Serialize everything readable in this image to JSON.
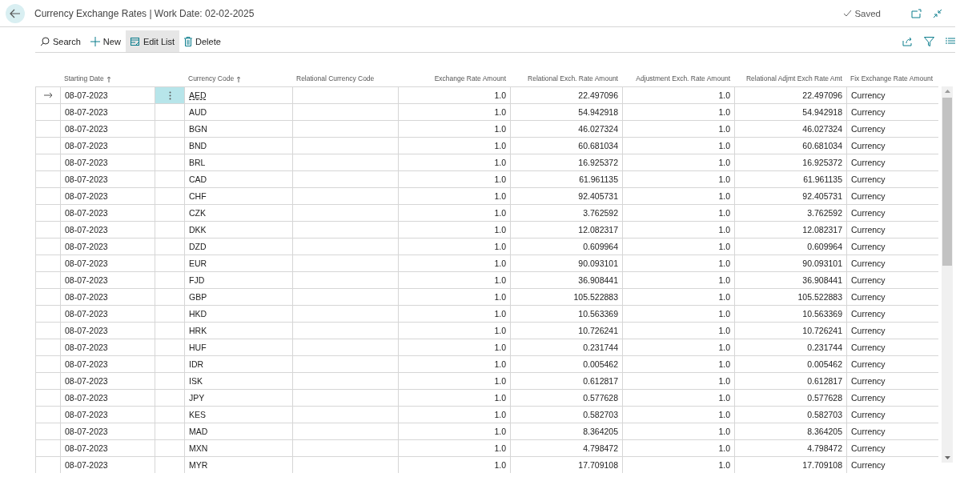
{
  "header": {
    "title": "Currency Exchange Rates | Work Date: 02-02-2025",
    "status": "Saved"
  },
  "actions": [
    {
      "label": "Search",
      "kind": "search",
      "selected": false
    },
    {
      "label": "New",
      "kind": "new",
      "selected": false
    },
    {
      "label": "Edit List",
      "kind": "edit",
      "selected": true
    },
    {
      "label": "Delete",
      "kind": "delete",
      "selected": false
    }
  ],
  "columns": [
    {
      "label": "Starting Date",
      "sorted": true,
      "kind": "text"
    },
    {
      "label": "Currency Code",
      "sorted": true,
      "kind": "text"
    },
    {
      "label": "Relational Currency Code",
      "sorted": false,
      "kind": "text"
    },
    {
      "label": "Exchange Rate Amount",
      "sorted": false,
      "kind": "number"
    },
    {
      "label": "Relational Exch. Rate Amount",
      "sorted": false,
      "kind": "number"
    },
    {
      "label": "Adjustment Exch. Rate Amount",
      "sorted": false,
      "kind": "number"
    },
    {
      "label": "Relational Adjmt Exch Rate Amt",
      "sorted": false,
      "kind": "number"
    },
    {
      "label": "Fix Exchange Rate Amount",
      "sorted": false,
      "kind": "text"
    }
  ],
  "rows": [
    {
      "selected": true,
      "cells": [
        "08-07-2023",
        "AED",
        "",
        "1.0",
        "22.497096",
        "1.0",
        "22.497096",
        "Currency"
      ]
    },
    {
      "selected": false,
      "cells": [
        "08-07-2023",
        "AUD",
        "",
        "1.0",
        "54.942918",
        "1.0",
        "54.942918",
        "Currency"
      ]
    },
    {
      "selected": false,
      "cells": [
        "08-07-2023",
        "BGN",
        "",
        "1.0",
        "46.027324",
        "1.0",
        "46.027324",
        "Currency"
      ]
    },
    {
      "selected": false,
      "cells": [
        "08-07-2023",
        "BND",
        "",
        "1.0",
        "60.681034",
        "1.0",
        "60.681034",
        "Currency"
      ]
    },
    {
      "selected": false,
      "cells": [
        "08-07-2023",
        "BRL",
        "",
        "1.0",
        "16.925372",
        "1.0",
        "16.925372",
        "Currency"
      ]
    },
    {
      "selected": false,
      "cells": [
        "08-07-2023",
        "CAD",
        "",
        "1.0",
        "61.961135",
        "1.0",
        "61.961135",
        "Currency"
      ]
    },
    {
      "selected": false,
      "cells": [
        "08-07-2023",
        "CHF",
        "",
        "1.0",
        "92.405731",
        "1.0",
        "92.405731",
        "Currency"
      ]
    },
    {
      "selected": false,
      "cells": [
        "08-07-2023",
        "CZK",
        "",
        "1.0",
        "3.762592",
        "1.0",
        "3.762592",
        "Currency"
      ]
    },
    {
      "selected": false,
      "cells": [
        "08-07-2023",
        "DKK",
        "",
        "1.0",
        "12.082317",
        "1.0",
        "12.082317",
        "Currency"
      ]
    },
    {
      "selected": false,
      "cells": [
        "08-07-2023",
        "DZD",
        "",
        "1.0",
        "0.609964",
        "1.0",
        "0.609964",
        "Currency"
      ]
    },
    {
      "selected": false,
      "cells": [
        "08-07-2023",
        "EUR",
        "",
        "1.0",
        "90.093101",
        "1.0",
        "90.093101",
        "Currency"
      ]
    },
    {
      "selected": false,
      "cells": [
        "08-07-2023",
        "FJD",
        "",
        "1.0",
        "36.908441",
        "1.0",
        "36.908441",
        "Currency"
      ]
    },
    {
      "selected": false,
      "cells": [
        "08-07-2023",
        "GBP",
        "",
        "1.0",
        "105.522883",
        "1.0",
        "105.522883",
        "Currency"
      ]
    },
    {
      "selected": false,
      "cells": [
        "08-07-2023",
        "HKD",
        "",
        "1.0",
        "10.563369",
        "1.0",
        "10.563369",
        "Currency"
      ]
    },
    {
      "selected": false,
      "cells": [
        "08-07-2023",
        "HRK",
        "",
        "1.0",
        "10.726241",
        "1.0",
        "10.726241",
        "Currency"
      ]
    },
    {
      "selected": false,
      "cells": [
        "08-07-2023",
        "HUF",
        "",
        "1.0",
        "0.231744",
        "1.0",
        "0.231744",
        "Currency"
      ]
    },
    {
      "selected": false,
      "cells": [
        "08-07-2023",
        "IDR",
        "",
        "1.0",
        "0.005462",
        "1.0",
        "0.005462",
        "Currency"
      ]
    },
    {
      "selected": false,
      "cells": [
        "08-07-2023",
        "ISK",
        "",
        "1.0",
        "0.612817",
        "1.0",
        "0.612817",
        "Currency"
      ]
    },
    {
      "selected": false,
      "cells": [
        "08-07-2023",
        "JPY",
        "",
        "1.0",
        "0.577628",
        "1.0",
        "0.577628",
        "Currency"
      ]
    },
    {
      "selected": false,
      "cells": [
        "08-07-2023",
        "KES",
        "",
        "1.0",
        "0.582703",
        "1.0",
        "0.582703",
        "Currency"
      ]
    },
    {
      "selected": false,
      "cells": [
        "08-07-2023",
        "MAD",
        "",
        "1.0",
        "8.364205",
        "1.0",
        "8.364205",
        "Currency"
      ]
    },
    {
      "selected": false,
      "cells": [
        "08-07-2023",
        "MXN",
        "",
        "1.0",
        "4.798472",
        "1.0",
        "4.798472",
        "Currency"
      ]
    },
    {
      "selected": false,
      "cells": [
        "08-07-2023",
        "MYR",
        "",
        "1.0",
        "17.709108",
        "1.0",
        "17.709108",
        "Currency"
      ]
    }
  ]
}
